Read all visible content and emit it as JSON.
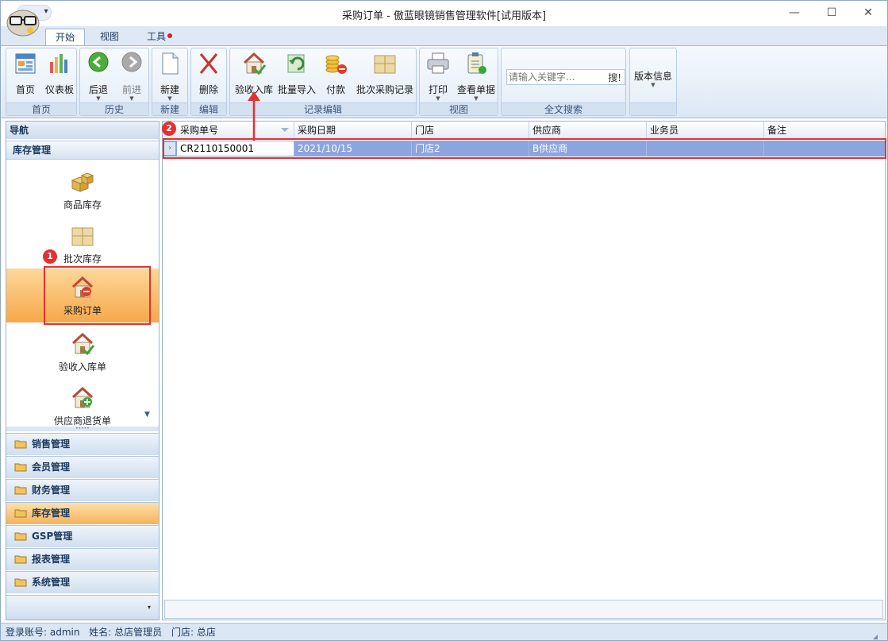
{
  "window": {
    "title": "采购订单 - 傲蓝眼镜销售管理软件[试用版本]",
    "qat_glyph": "▾",
    "minimize": "—",
    "maximize": "☐",
    "close": "✕"
  },
  "tabs": [
    {
      "label": "开始",
      "active": true
    },
    {
      "label": "视图",
      "active": false
    },
    {
      "label": "工具",
      "active": false,
      "has_dot": true
    }
  ],
  "ribbon": {
    "groups": [
      {
        "title": "首页",
        "buttons": [
          {
            "label": "首页",
            "icon": "home-icon"
          },
          {
            "label": "仪表板",
            "icon": "dashboard-icon"
          }
        ]
      },
      {
        "title": "历史",
        "buttons": [
          {
            "label": "后退",
            "icon": "back-icon"
          },
          {
            "label": "前进",
            "icon": "forward-icon",
            "disabled": true
          }
        ]
      },
      {
        "title": "新建",
        "buttons": [
          {
            "label": "新建",
            "icon": "new-document-icon"
          }
        ]
      },
      {
        "title": "编辑",
        "buttons": [
          {
            "label": "删除",
            "icon": "delete-icon"
          }
        ]
      },
      {
        "title": "记录编辑",
        "buttons": [
          {
            "label": "验收入库",
            "icon": "receive-stock-icon"
          },
          {
            "label": "批量导入",
            "icon": "batch-import-icon"
          },
          {
            "label": "付款",
            "icon": "payment-icon"
          },
          {
            "label": "批次采购记录",
            "icon": "batch-purchase-icon"
          }
        ]
      },
      {
        "title": "视图",
        "buttons": [
          {
            "label": "打印",
            "icon": "print-icon"
          },
          {
            "label": "查看单据",
            "icon": "view-document-icon"
          }
        ]
      },
      {
        "title": "全文搜索",
        "search_placeholder": "请输入关键字...",
        "search_button": "搜!"
      },
      {
        "title": "",
        "buttons": [
          {
            "label": "版本信息",
            "icon": "version-info-icon"
          }
        ]
      }
    ]
  },
  "nav": {
    "header": "导航",
    "section": "库存管理",
    "items": [
      {
        "label": "商品库存",
        "icon": "boxes-icon"
      },
      {
        "label": "批次库存",
        "icon": "batch-box-icon"
      },
      {
        "label": "采购订单",
        "icon": "purchase-order-icon",
        "selected": true
      },
      {
        "label": "验收入库单",
        "icon": "house-check-icon"
      },
      {
        "label": "供应商退货单",
        "icon": "house-add-icon"
      }
    ],
    "categories": [
      {
        "label": "销售管理",
        "active": false
      },
      {
        "label": "会员管理",
        "active": false
      },
      {
        "label": "财务管理",
        "active": false
      },
      {
        "label": "库存管理",
        "active": true
      },
      {
        "label": "GSP管理",
        "active": false
      },
      {
        "label": "报表管理",
        "active": false
      },
      {
        "label": "系统管理",
        "active": false
      }
    ],
    "grip": "•••••",
    "scroll_glyph": "▼",
    "foot_glyph": "▾"
  },
  "grid": {
    "columns": [
      "采购单号",
      "采购日期",
      "门店",
      "供应商",
      "业务员",
      "备注"
    ],
    "rows": [
      [
        "CR2110150001",
        "2021/10/15",
        "门店2",
        "B供应商",
        "",
        ""
      ]
    ],
    "row_indicator": "›"
  },
  "annotations": {
    "badge1": "1",
    "badge2": "2",
    "color": "#e5302f"
  },
  "status": {
    "account": "登录账号: admin",
    "name": "姓名: 总店管理员",
    "store": "门店: 总店"
  }
}
